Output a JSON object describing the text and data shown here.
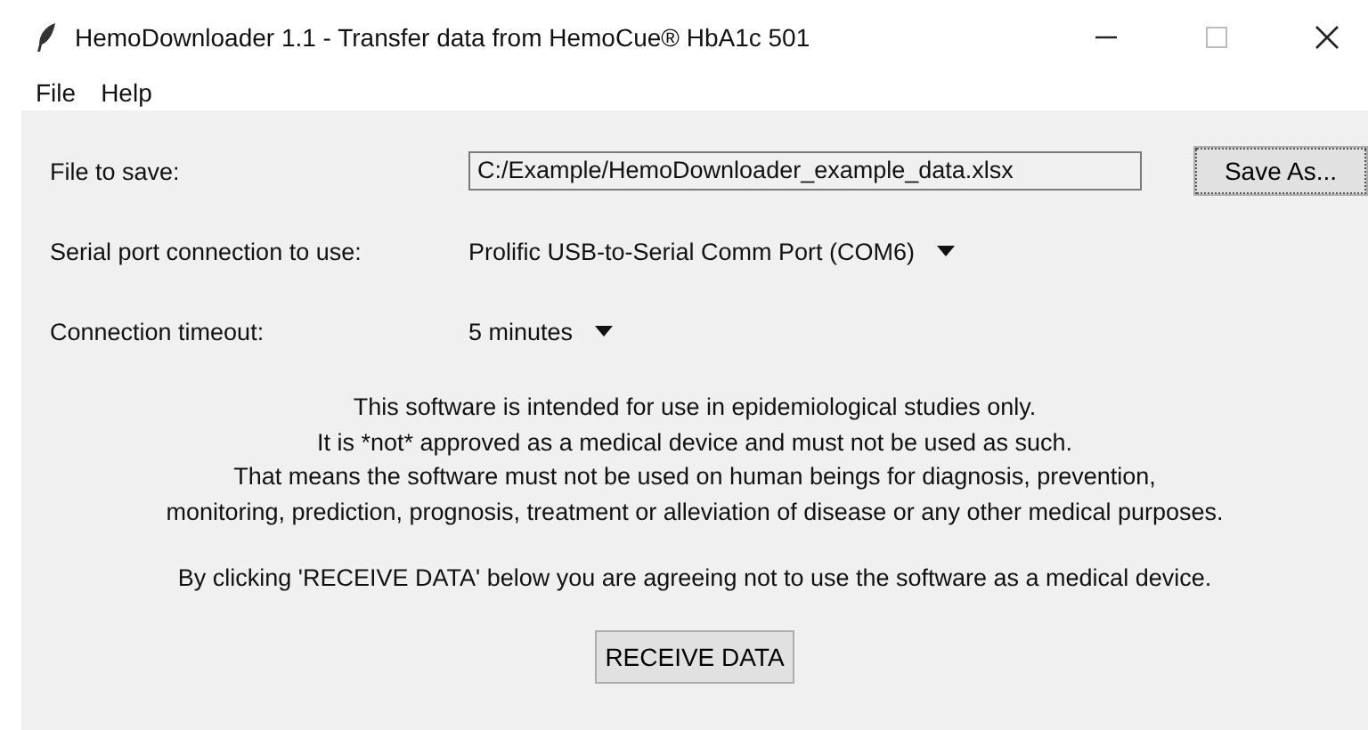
{
  "window": {
    "title": "HemoDownloader 1.1 - Transfer data from HemoCue® HbA1c 501"
  },
  "menu": [
    "File",
    "Help"
  ],
  "file_row": {
    "label": "File to save:",
    "value": "C:/Example/HemoDownloader_example_data.xlsx",
    "button": "Save As..."
  },
  "serial_row": {
    "label": "Serial port connection to use:",
    "value": "Prolific USB-to-Serial Comm Port (COM6)"
  },
  "timeout_row": {
    "label": "Connection timeout:",
    "value": "5 minutes"
  },
  "notice": [
    "This software is intended for use in epidemiological studies only.",
    "It is *not* approved as a medical device and must not be used as such.",
    "That means the software must not be used on human beings for diagnosis, prevention,",
    "monitoring, prediction, prognosis, treatment or alleviation of disease or any other medical purposes."
  ],
  "agreement": "By clicking 'RECEIVE DATA' below you are agreeing not to use the software as a medical device.",
  "receive_button": "RECEIVE DATA"
}
